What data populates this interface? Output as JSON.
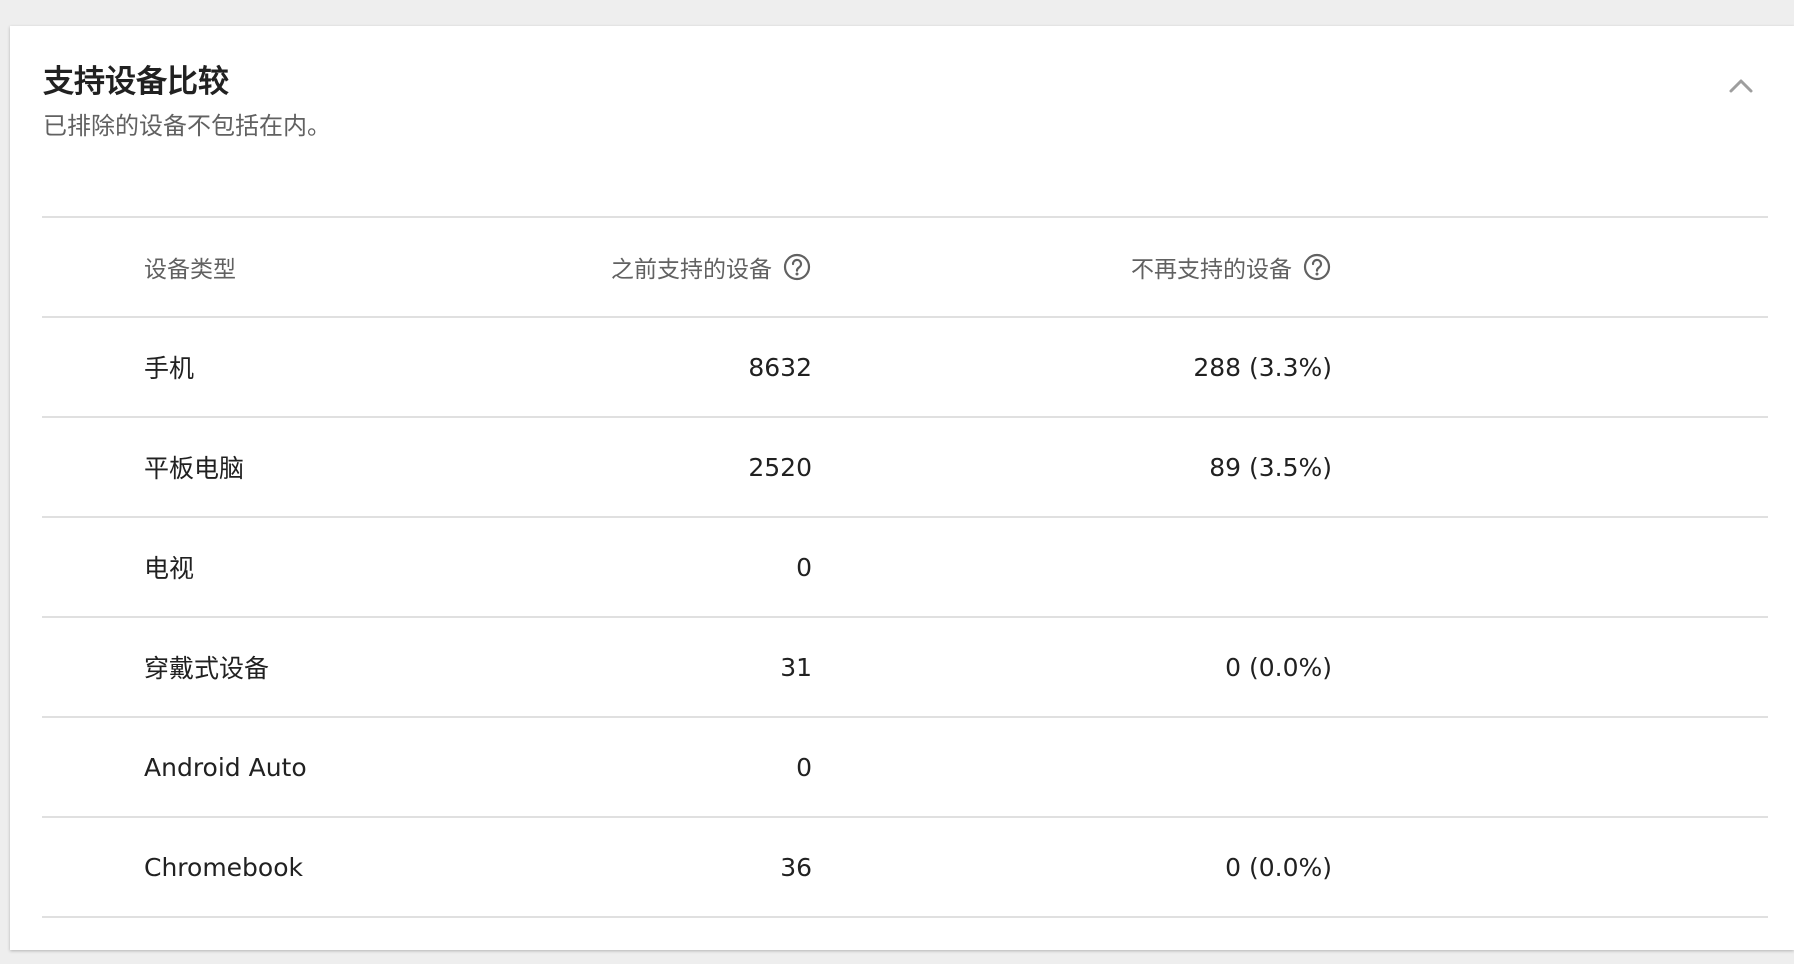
{
  "card": {
    "title": "支持设备比较",
    "subtitle": "已排除的设备不包括在内。",
    "collapse_icon": "chevron-up-icon"
  },
  "table": {
    "headers": {
      "device_type": "设备类型",
      "previously_supported": "之前支持的设备",
      "no_longer_supported": "不再支持的设备"
    },
    "header_icon": "help-circle-icon",
    "rows": [
      {
        "device_type": "手机",
        "previously_supported": "8632",
        "no_longer_supported": "288 (3.3%)"
      },
      {
        "device_type": "平板电脑",
        "previously_supported": "2520",
        "no_longer_supported": "89 (3.5%)"
      },
      {
        "device_type": "电视",
        "previously_supported": "0",
        "no_longer_supported": ""
      },
      {
        "device_type": "穿戴式设备",
        "previously_supported": "31",
        "no_longer_supported": "0 (0.0%)"
      },
      {
        "device_type": "Android Auto",
        "previously_supported": "0",
        "no_longer_supported": ""
      },
      {
        "device_type": "Chromebook",
        "previously_supported": "36",
        "no_longer_supported": "0 (0.0%)"
      }
    ]
  },
  "colors": {
    "background": "#eeeeee",
    "card": "#ffffff",
    "text_primary": "#212121",
    "text_secondary": "#616161",
    "divider": "#e0e0e0"
  }
}
